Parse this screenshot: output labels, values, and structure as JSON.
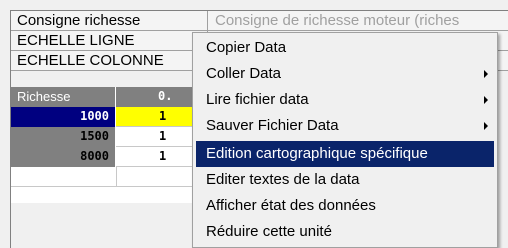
{
  "properties": [
    {
      "name": "Consigne richesse",
      "value": "Consigne de richesse moteur (riches"
    },
    {
      "name": "ECHELLE LIGNE",
      "value": ""
    },
    {
      "name": "ECHELLE COLONNE",
      "value": ""
    }
  ],
  "grid": {
    "header_label": "Richesse",
    "header_col": "0.",
    "rows": [
      {
        "label": "1000",
        "value": "1"
      },
      {
        "label": "1500",
        "value": "1"
      },
      {
        "label": "8000",
        "value": "1"
      }
    ]
  },
  "context_menu": {
    "items": [
      {
        "label": "Copier Data",
        "submenu": false
      },
      {
        "label": "Coller Data",
        "submenu": true
      },
      {
        "label": "Lire fichier data",
        "submenu": true
      },
      {
        "label": "Sauver Fichier Data",
        "submenu": true
      },
      {
        "label": "Edition cartographique spécifique",
        "submenu": false,
        "highlighted": true
      },
      {
        "label": "Editer textes de la data",
        "submenu": false
      },
      {
        "label": "Afficher état des données",
        "submenu": false
      },
      {
        "label": "Réduire cette unité",
        "submenu": false
      }
    ]
  },
  "colors": {
    "selection": "#0a246a",
    "cell_highlight": "#ffff00",
    "row_selected": "#000080"
  }
}
